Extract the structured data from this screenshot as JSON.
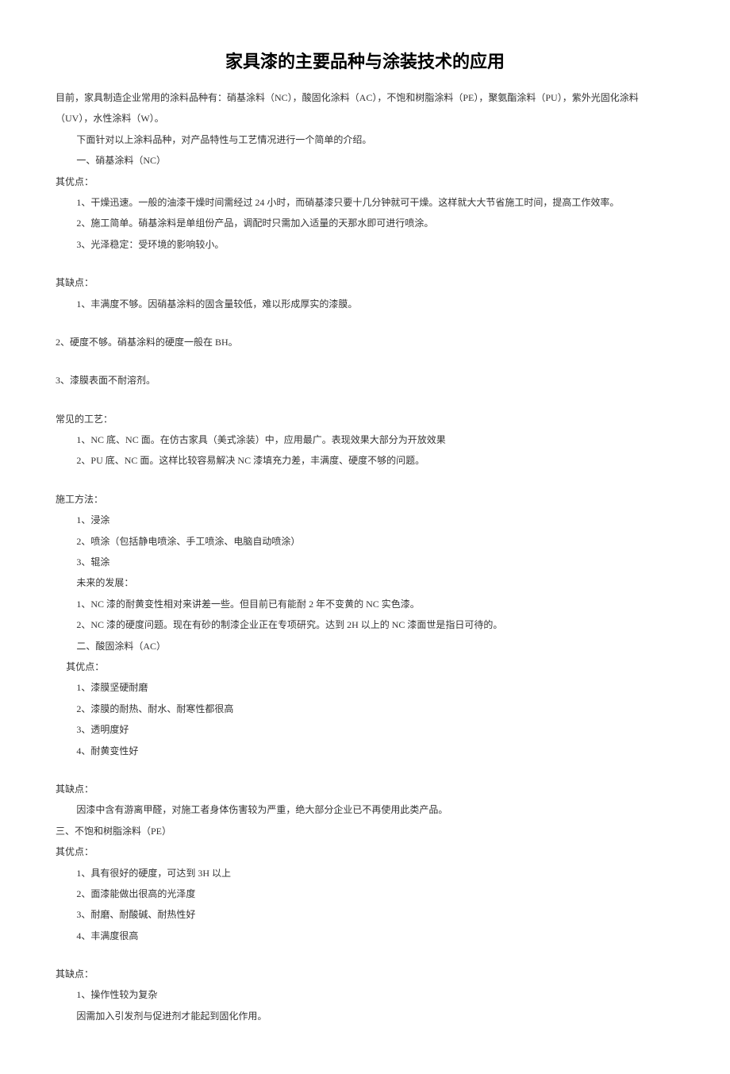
{
  "title": "家具漆的主要品种与涂装技术的应用",
  "intro": "目前，家具制造企业常用的涂料品种有：硝基涂料（NC），酸固化涂料（AC），不饱和树脂涂料（PE），聚氨酯涂料（PU），紫外光固化涂料（UV），水性涂料（W）。",
  "intro2": "下面针对以上涂料品种，对产品特性与工艺情况进行一个简单的介绍。",
  "s1": {
    "heading": "一、硝基涂料（NC）",
    "adv_label": "其优点：",
    "adv": [
      "1、干燥迅速。一般的油漆干燥时间需经过 24 小时，而硝基漆只要十几分钟就可干燥。这样就大大节省施工时间，提高工作效率。",
      "2、施工简单。硝基涂料是单组份产品，调配时只需加入适量的天那水即可进行喷涂。",
      "3、光泽稳定：受环境的影响较小。"
    ],
    "dis_label": "其缺点：",
    "dis1": "1、丰满度不够。因硝基涂料的固含量较低，难以形成厚实的漆膜。",
    "dis2": "2、硬度不够。硝基涂料的硬度一般在 BH。",
    "dis3": "3、漆膜表面不耐溶剂。",
    "craft_label": "常见的工艺：",
    "craft": [
      "1、NC 底、NC 面。在仿古家具（美式涂装）中，应用最广。表现效果大部分为开放效果",
      "2、PU 底、NC 面。这样比较容易解决 NC 漆填充力差，丰满度、硬度不够的问题。"
    ],
    "method_label": "施工方法：",
    "method": [
      "1、浸涂",
      "2、喷涂（包括静电喷涂、手工喷涂、电脑自动喷涂）",
      "3、辊涂"
    ],
    "future_label": "未来的发展：",
    "future": [
      "1、NC 漆的耐黄变性相对来讲差一些。但目前已有能耐 2 年不变黄的 NC 实色漆。",
      "2、NC 漆的硬度问题。现在有砂的制漆企业正在专项研究。达到 2H 以上的 NC 漆面世是指日可待的。"
    ]
  },
  "s2": {
    "heading": "二、酸固涂料（AC）",
    "adv_label": "其优点：",
    "adv": [
      "1、漆膜坚硬耐磨",
      "2、漆膜的耐热、耐水、耐寒性都很高",
      "3、透明度好",
      "4、耐黄变性好"
    ],
    "dis_label": "其缺点：",
    "dis": "因漆中含有游离甲醛，对施工者身体伤害较为严重，绝大部分企业已不再使用此类产品。"
  },
  "s3": {
    "heading": "三、不饱和树脂涂料（PE）",
    "adv_label": "其优点：",
    "adv": [
      "1、具有很好的硬度，可达到 3H 以上",
      "2、面漆能做出很高的光泽度",
      "3、耐磨、耐酸碱、耐热性好",
      "4、丰满度很高"
    ],
    "dis_label": "其缺点：",
    "dis": [
      "1、操作性较为复杂",
      "因需加入引发剂与促进剂才能起到固化作用。"
    ]
  }
}
